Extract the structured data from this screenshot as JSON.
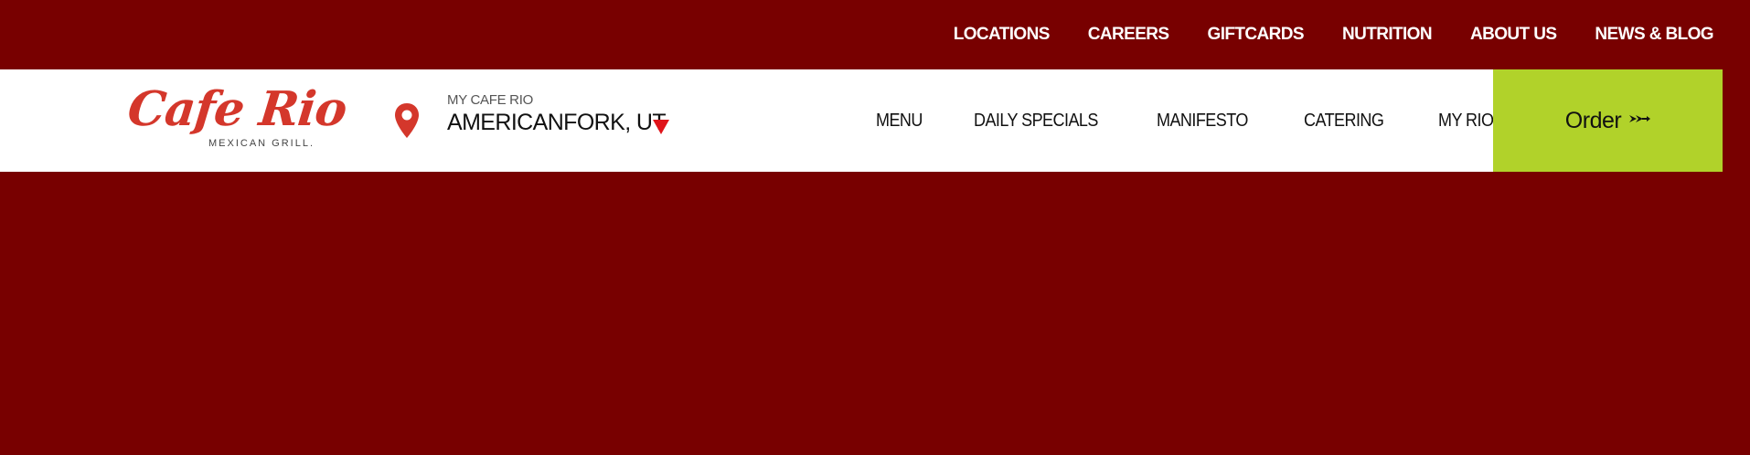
{
  "top_nav": {
    "items": [
      "LOCATIONS",
      "CAREERS",
      "GIFTCARDS",
      "NUTRITION",
      "ABOUT US",
      "NEWS & BLOG"
    ]
  },
  "logo": {
    "name": "Cafe Rio",
    "tagline": "MEXICAN GRILL."
  },
  "location": {
    "label": "MY CAFE RIO",
    "value": "AMERICANFORK, UT",
    "icon": "map-pin-icon",
    "caret_icon": "triangle-down-icon"
  },
  "main_nav": {
    "items": [
      "MENU",
      "DAILY SPECIALS",
      "MANIFESTO",
      "CATERING",
      "MY RIO REWARDS"
    ]
  },
  "order_button": {
    "label": "Order",
    "icon": "arrow-right-icon"
  },
  "colors": {
    "background": "#780000",
    "header": "#ffffff",
    "brand_red": "#d4372b",
    "caret_red": "#e0141a",
    "order_green": "#b1d22a"
  }
}
